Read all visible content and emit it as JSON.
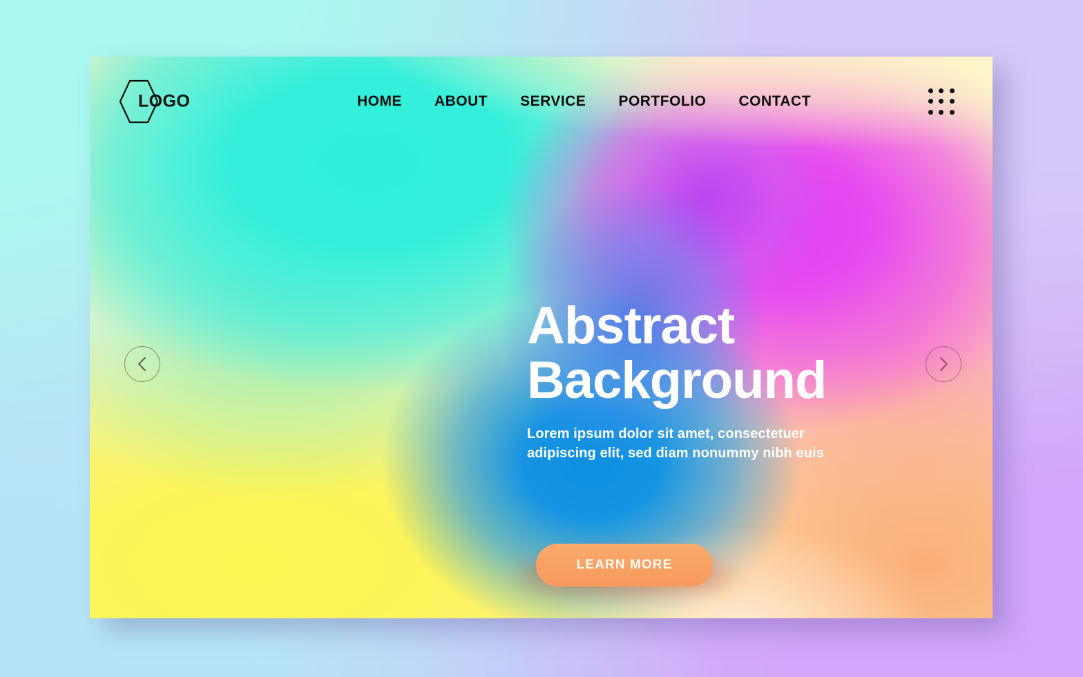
{
  "header": {
    "logo": {
      "text": "LOGO",
      "shape": "hexagon-outline-icon"
    },
    "nav": [
      {
        "label": "HOME"
      },
      {
        "label": "ABOUT"
      },
      {
        "label": "SERVICE"
      },
      {
        "label": "PORTFOLIO"
      },
      {
        "label": "CONTACT"
      }
    ],
    "menu_icon": "grid-dots-icon"
  },
  "hero": {
    "title": "Abstract\nBackground",
    "subtitle": "Lorem ipsum dolor sit amet, consectetuer\nadipiscing elit, sed diam nonummy nibh euis",
    "cta_label": "LEARN MORE"
  },
  "slider": {
    "prev_icon": "chevron-left-icon",
    "next_icon": "chevron-right-icon"
  },
  "colors": {
    "cta": "#f8a063",
    "heading": "#ffffff",
    "nav_text": "#0d0d0d",
    "mesh_cyan": "#2ef0dd",
    "mesh_yellow": "#fbf653",
    "mesh_blue": "#0e8fe0",
    "mesh_magenta": "#e040f2",
    "mesh_pink": "#fc8cbe",
    "mesh_orange": "#fba66e",
    "mesh_cream": "#fdf6cf",
    "backdrop_aqua": "#a8f8f0",
    "backdrop_blue": "#b6e4f7",
    "backdrop_lavender": "#d5c7f8",
    "backdrop_violet": "#d2a6fa"
  }
}
